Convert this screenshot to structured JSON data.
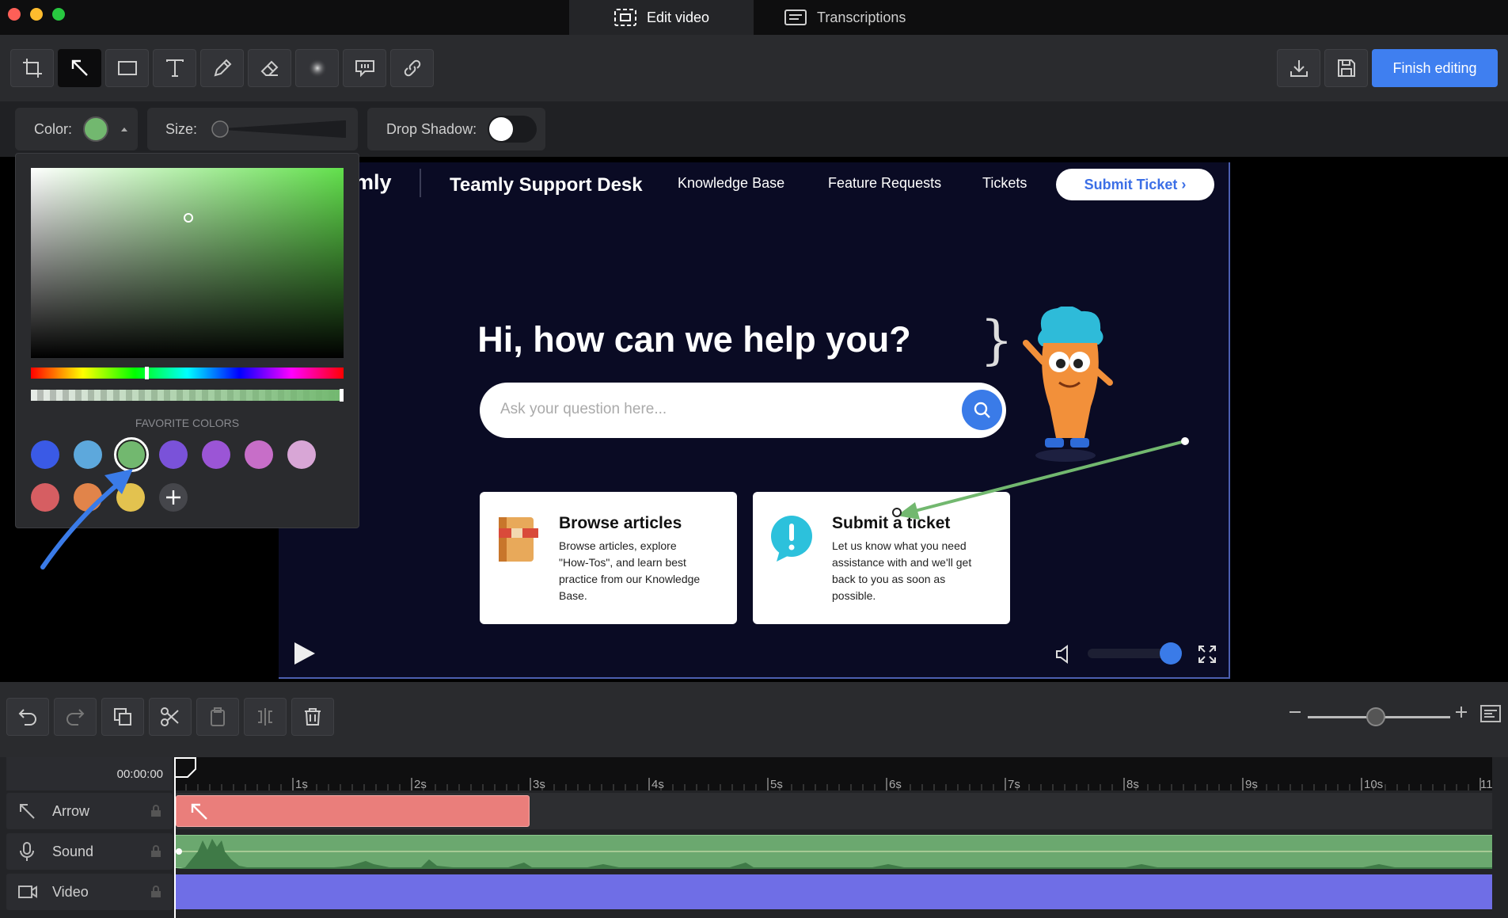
{
  "tabs": {
    "edit_video": "Edit video",
    "transcriptions": "Transcriptions"
  },
  "toolbar": {
    "tools": [
      "crop-icon",
      "arrow-icon",
      "rectangle-icon",
      "text-icon",
      "pencil-icon",
      "eraser-icon",
      "blur-icon",
      "callout-icon",
      "link-icon"
    ],
    "finish_label": "Finish editing"
  },
  "options": {
    "color_label": "Color:",
    "color_value": "#72b86f",
    "size_label": "Size:",
    "drop_shadow_label": "Drop Shadow:"
  },
  "picker": {
    "favorites_label": "FAVORITE COLORS",
    "swatches": [
      "#3a5ae6",
      "#5da8dc",
      "#72b86f",
      "#7a52d9",
      "#9b55d6",
      "#c76ec8",
      "#d8a6d6",
      "#d65e62",
      "#e1844a",
      "#e3c24f"
    ]
  },
  "video": {
    "logo_fragment": "mly",
    "site_title": "Teamly Support Desk",
    "nav": [
      "Knowledge Base",
      "Feature Requests",
      "Tickets"
    ],
    "submit_btn": "Submit Ticket ›",
    "hero": "Hi, how can we help you?",
    "search_placeholder": "Ask your question here...",
    "cards": [
      {
        "title": "Browse articles",
        "body": "Browse articles, explore \"How-Tos\", and learn best practice from our Knowledge Base."
      },
      {
        "title": "Submit a ticket",
        "body": "Let us know what you need assistance with and we'll get back to you as soon as possible."
      }
    ],
    "volume_level": 0.95
  },
  "timeline": {
    "timecode": "00:00:00",
    "ticks": [
      "1s",
      "2s",
      "3s",
      "4s",
      "5s",
      "6s",
      "7s",
      "8s",
      "9s",
      "10s",
      "11"
    ],
    "tracks": [
      "Arrow",
      "Sound",
      "Video"
    ],
    "zoom_level": 0.48
  }
}
